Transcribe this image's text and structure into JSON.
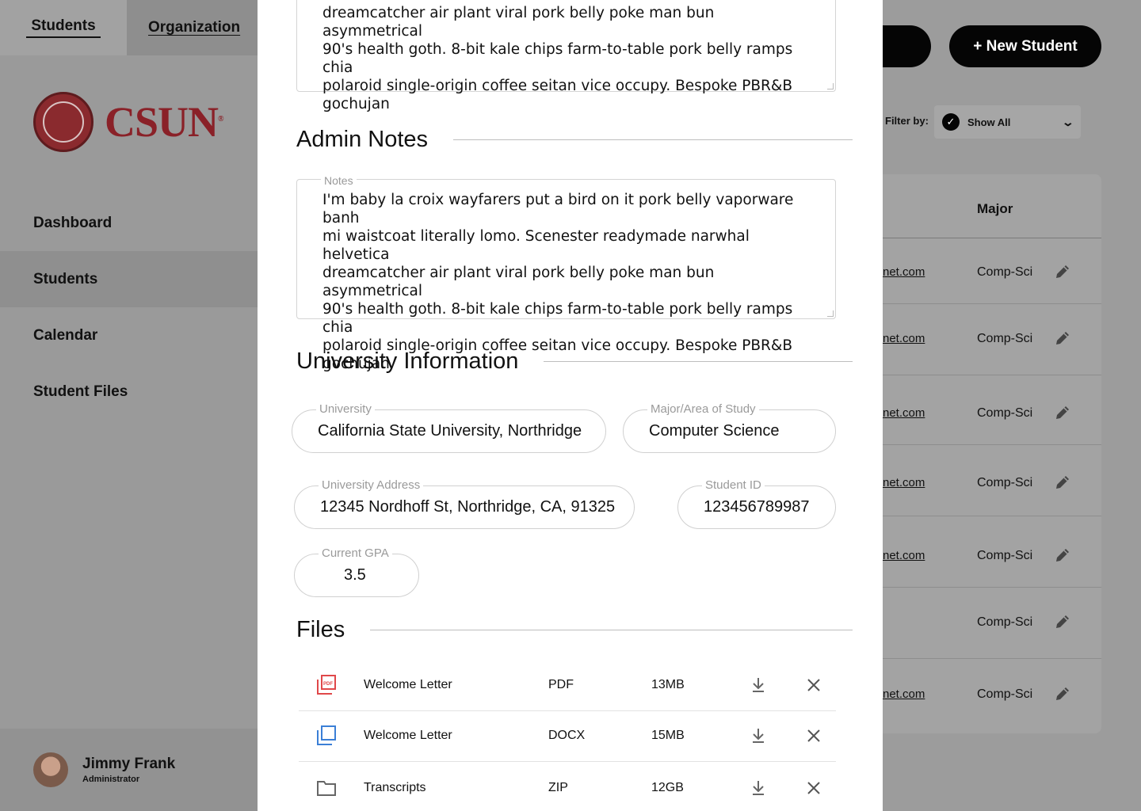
{
  "top_tabs": [
    {
      "label": "Students"
    },
    {
      "label": "Organization"
    }
  ],
  "logo": {
    "text": "CSUN",
    "reg": "®"
  },
  "sidebar": {
    "items": [
      {
        "label": "Dashboard"
      },
      {
        "label": "Students"
      },
      {
        "label": "Calendar"
      },
      {
        "label": "Student Files"
      }
    ]
  },
  "profile": {
    "name": "Jimmy Frank",
    "role": "Administrator"
  },
  "header": {
    "new_student_label": "+ New Student",
    "other_button_label": ""
  },
  "filter": {
    "label": "Filter by:",
    "selected": "Show All"
  },
  "table": {
    "major_header": "Major",
    "rows": [
      {
        "email": "net.com",
        "major": "Comp-Sci"
      },
      {
        "email": "net.com",
        "major": "Comp-Sci"
      },
      {
        "email": "net.com",
        "major": "Comp-Sci"
      },
      {
        "email": "net.com",
        "major": "Comp-Sci"
      },
      {
        "email": "net.com",
        "major": "Comp-Sci"
      },
      {
        "email": "",
        "major": "Comp-Sci"
      },
      {
        "email": "net.com",
        "major": "Comp-Sci"
      }
    ]
  },
  "modal": {
    "top_notes_lines": [
      "dreamcatcher air plant viral pork belly poke man bun asymmetrical",
      "90's health goth. 8-bit kale chips farm-to-table pork belly ramps chia",
      "polaroid single-origin coffee seitan vice occupy. Bespoke PBR&B",
      "gochujan"
    ],
    "admin_notes": {
      "title": "Admin Notes",
      "label": "Notes",
      "lines": [
        "I'm baby la croix wayfarers put a bird on it pork belly vaporware banh",
        "mi waistcoat literally lomo. Scenester readymade narwhal helvetica",
        "dreamcatcher air plant viral pork belly poke man bun asymmetrical",
        "90's health goth. 8-bit kale chips farm-to-table pork belly ramps chia",
        "polaroid single-origin coffee seitan vice occupy. Bespoke PBR&B",
        "gochujan"
      ]
    },
    "university": {
      "title": "University Information",
      "university_label": "University",
      "university_value": "California State University, Northridge",
      "major_label": "Major/Area of Study",
      "major_value": "Computer Science",
      "address_label": "University Address",
      "address_value": "12345 Nordhoff St, Northridge, CA, 91325",
      "student_id_label": "Student ID",
      "student_id_value": "123456789987",
      "gpa_label": "Current GPA",
      "gpa_value": "3.5"
    },
    "files": {
      "title": "Files",
      "items": [
        {
          "name": "Welcome Letter",
          "type": "PDF",
          "size": "13MB",
          "icon": "pdf-icon"
        },
        {
          "name": "Welcome Letter",
          "type": "DOCX",
          "size": "15MB",
          "icon": "doc-icon"
        },
        {
          "name": "Transcripts",
          "type": "ZIP",
          "size": "12GB",
          "icon": "folder-icon"
        }
      ]
    }
  },
  "colors": {
    "brand": "#8a2128",
    "pdf": "#e0484a",
    "doc": "#3b7fd6",
    "overlay": "#9c9c9c"
  }
}
